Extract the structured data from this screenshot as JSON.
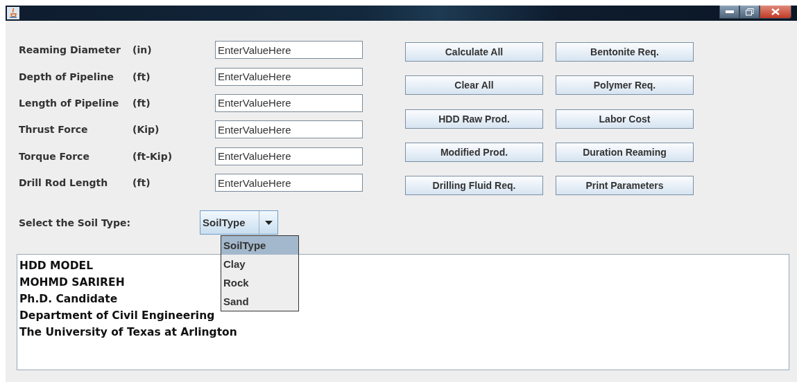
{
  "fields": [
    {
      "label": "Reaming Diameter",
      "unit": "(in)",
      "value": "EnterValueHere"
    },
    {
      "label": "Depth of Pipeline",
      "unit": "(ft)",
      "value": "EnterValueHere"
    },
    {
      "label": "Length of Pipeline",
      "unit": "(ft)",
      "value": "EnterValueHere"
    },
    {
      "label": "Thrust Force",
      "unit": "(Kip)",
      "value": "EnterValueHere"
    },
    {
      "label": "Torque Force",
      "unit": "(ft-Kip)",
      "value": "EnterValueHere"
    },
    {
      "label": "Drill Rod Length",
      "unit": "(ft)",
      "value": "EnterValueHere"
    }
  ],
  "buttons": [
    "Calculate All",
    "Bentonite Req.",
    "Clear All",
    "Polymer Req.",
    "HDD Raw Prod.",
    "Labor Cost",
    "Modified Prod.",
    "Duration Reaming",
    "Drilling Fluid Req.",
    "Print Parameters"
  ],
  "soil": {
    "label": "Select the Soil Type:",
    "value": "SoilType",
    "expanded": true,
    "options": [
      {
        "label": "SoilType",
        "selected": true
      },
      {
        "label": "Clay",
        "selected": false
      },
      {
        "label": "Rock",
        "selected": false
      },
      {
        "label": "Sand",
        "selected": false
      }
    ]
  },
  "output_lines": [
    "HDD MODEL",
    "MOHMD SARIREH",
    "Ph.D. Candidate",
    "Department of Civil Engineering",
    "The University of Texas at Arlington"
  ]
}
